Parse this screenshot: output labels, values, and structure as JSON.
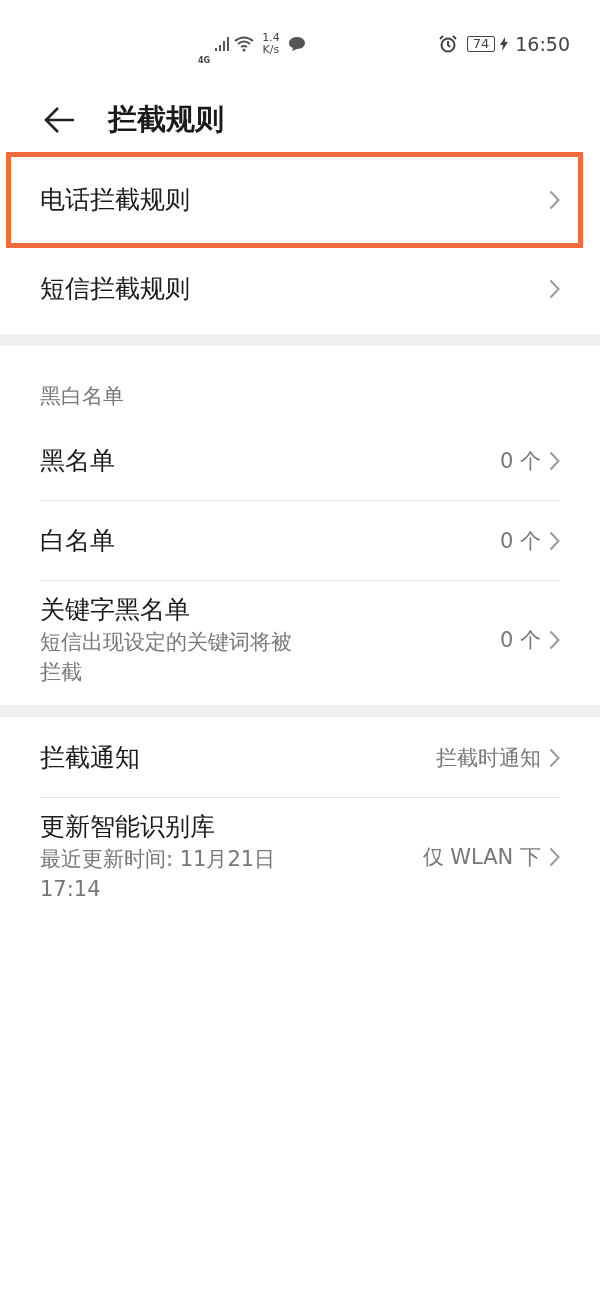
{
  "status_bar": {
    "network": "4G",
    "speed_value": "1.4",
    "speed_unit": "K/s",
    "battery": "74",
    "time": "16:50"
  },
  "header": {
    "title": "拦截规则"
  },
  "sections": [
    {
      "items": [
        {
          "title": "电话拦截规则",
          "highlighted": true
        },
        {
          "title": "短信拦截规则",
          "highlighted": false
        }
      ]
    },
    {
      "heading": "黑白名单",
      "items": [
        {
          "title": "黑名单",
          "value": "0 个",
          "highlighted": false
        },
        {
          "title": "白名单",
          "value": "0 个",
          "highlighted": false
        },
        {
          "title": "关键字黑名单",
          "subtitle": "短信出现设定的关键词将被拦截",
          "value": "0 个",
          "highlighted": false
        }
      ]
    },
    {
      "items": [
        {
          "title": "拦截通知",
          "value": "拦截时通知",
          "highlighted": false
        },
        {
          "title": "更新智能识别库",
          "subtitle": "最近更新时间: 11月21日 17:14",
          "value": "仅 WLAN 下",
          "highlighted": false
        }
      ]
    }
  ]
}
